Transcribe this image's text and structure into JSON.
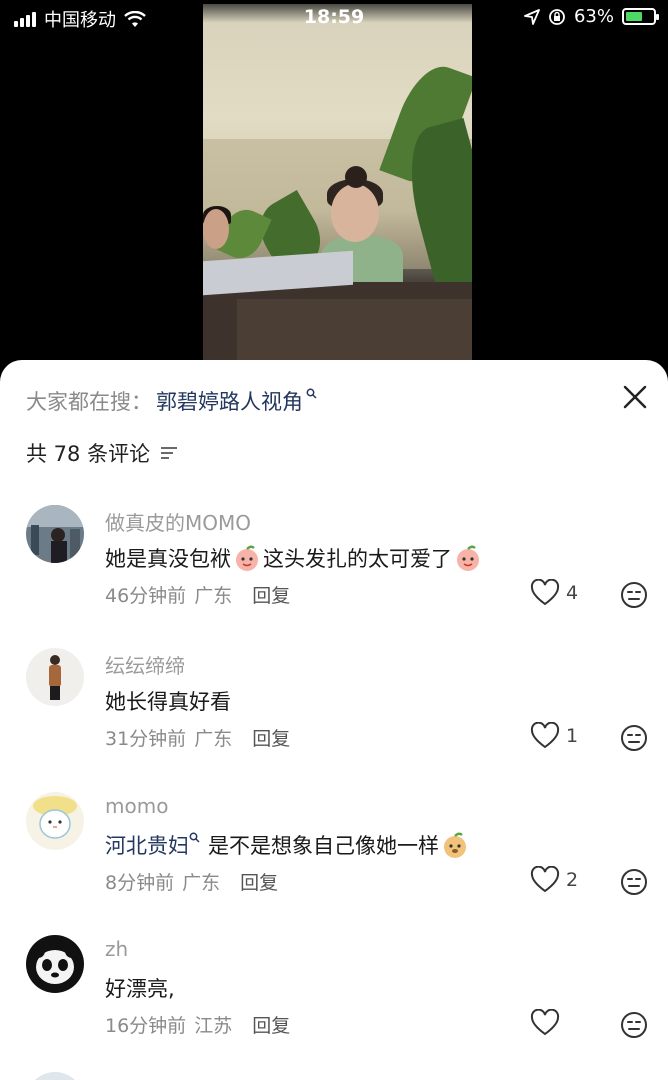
{
  "status_bar": {
    "carrier": "中国移动",
    "time": "18:59",
    "battery_percent": "63%",
    "battery_level": 0.63
  },
  "sheet": {
    "search_prefix": "大家都在搜：",
    "search_term": "郭碧婷路人视角",
    "comment_count": "共 78 条评论"
  },
  "comments": [
    {
      "user": "做真皮的MOMO",
      "text_a": "她是真没包袱",
      "text_b": "这头发扎的太可爱了",
      "time": "46分钟前",
      "location": "广东",
      "reply": "回复",
      "likes": "4"
    },
    {
      "user": "纭纭缔缔",
      "text_a": "她长得真好看",
      "time": "31分钟前",
      "location": "广东",
      "reply": "回复",
      "likes": "1"
    },
    {
      "user": "momo",
      "mention": "河北贵妇",
      "text_a": "是不是想象自己像她一样",
      "time": "8分钟前",
      "location": "广东",
      "reply": "回复",
      "likes": "2"
    },
    {
      "user": "zh",
      "text_a": "好漂亮,",
      "time": "16分钟前",
      "location": "江苏",
      "reply": "回复",
      "likes": ""
    }
  ],
  "colors": {
    "link": "#24385f",
    "battery": "#4cd964"
  }
}
